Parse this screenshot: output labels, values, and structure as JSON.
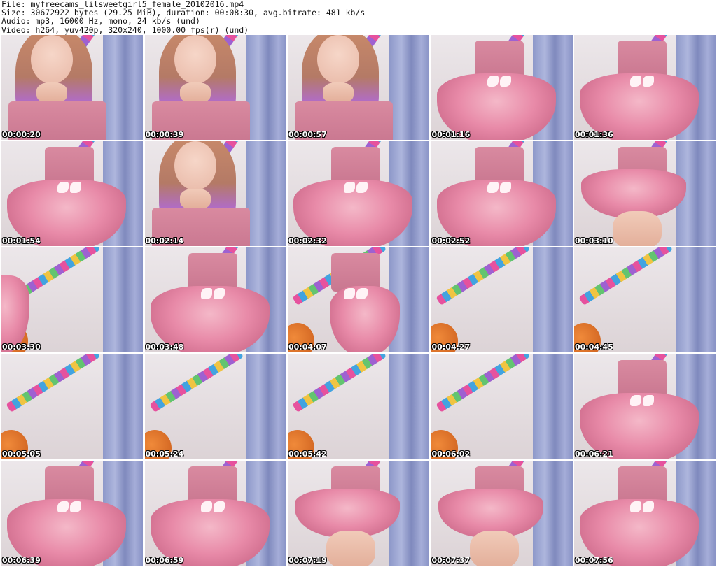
{
  "header": {
    "file": "File: myfreecams_lilsweetgirl5_female_20102016.mp4",
    "size": "Size: 30672922 bytes (29.25 MiB), duration: 00:08:30, avg.bitrate: 481 kb/s",
    "audio": "Audio: mp3, 16000 Hz, mono, 24 kb/s (und)",
    "video": "Video: h264, yuv420p, 320x240, 1000.00 fps(r) (und)"
  },
  "thumbnails": [
    {
      "time": "00:00:20",
      "scene": "face"
    },
    {
      "time": "00:00:39",
      "scene": "face"
    },
    {
      "time": "00:00:57",
      "scene": "face"
    },
    {
      "time": "00:01:16",
      "scene": "dress-spin"
    },
    {
      "time": "00:01:36",
      "scene": "dress-wide"
    },
    {
      "time": "00:01:54",
      "scene": "dress-wide"
    },
    {
      "time": "00:02:14",
      "scene": "face-side"
    },
    {
      "time": "00:02:32",
      "scene": "dress"
    },
    {
      "time": "00:02:52",
      "scene": "dress-arms"
    },
    {
      "time": "00:03:10",
      "scene": "skirt-lift"
    },
    {
      "time": "00:03:30",
      "scene": "room-edge"
    },
    {
      "time": "00:03:48",
      "scene": "dress-close"
    },
    {
      "time": "00:04:07",
      "scene": "dress-back"
    },
    {
      "time": "00:04:27",
      "scene": "room"
    },
    {
      "time": "00:04:45",
      "scene": "room"
    },
    {
      "time": "00:05:05",
      "scene": "room"
    },
    {
      "time": "00:05:24",
      "scene": "room"
    },
    {
      "time": "00:05:42",
      "scene": "room"
    },
    {
      "time": "00:06:02",
      "scene": "room"
    },
    {
      "time": "00:06:21",
      "scene": "dress-close"
    },
    {
      "time": "00:06:39",
      "scene": "dress-wide"
    },
    {
      "time": "00:06:59",
      "scene": "dress-side"
    },
    {
      "time": "00:07:19",
      "scene": "skirt-lift"
    },
    {
      "time": "00:07:37",
      "scene": "skirt-lift"
    },
    {
      "time": "00:07:56",
      "scene": "dress"
    }
  ]
}
